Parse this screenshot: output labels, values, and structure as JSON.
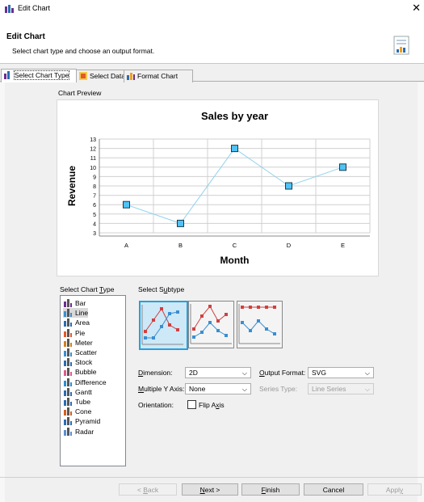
{
  "window": {
    "title": "Edit Chart"
  },
  "header": {
    "title": "Edit Chart",
    "subtitle": "Select chart type and choose an output format."
  },
  "tabs": [
    {
      "label": "Select Chart Type"
    },
    {
      "label": "Select Data"
    },
    {
      "label": "Format Chart"
    }
  ],
  "preview": {
    "label": "Chart Preview"
  },
  "chart_data": {
    "type": "line",
    "title": "Sales by year",
    "xlabel": "Month",
    "ylabel": "Revenue",
    "categories": [
      "A",
      "B",
      "C",
      "D",
      "E"
    ],
    "values": [
      6,
      4,
      12,
      8,
      10
    ],
    "ylim": [
      3,
      13
    ],
    "yticks": [
      3,
      4,
      5,
      6,
      7,
      8,
      9,
      10,
      11,
      12,
      13
    ],
    "grid": true,
    "line_color": "#8fd3ef",
    "marker_color": "#4fc3f7"
  },
  "chart_type": {
    "label_pre": "Select Chart ",
    "label_u": "T",
    "label_post": "ype",
    "items": [
      "Bar",
      "Line",
      "Area",
      "Pie",
      "Meter",
      "Scatter",
      "Stock",
      "Bubble",
      "Difference",
      "Gantt",
      "Tube",
      "Cone",
      "Pyramid",
      "Radar"
    ],
    "selected": "Line"
  },
  "subtype": {
    "label_pre": "Select S",
    "label_u": "u",
    "label_post": "btype"
  },
  "form": {
    "dimension_label": "Dimension:",
    "dimension_value": "2D",
    "multiple_y_label": "Multiple Y Axis:",
    "multiple_y_value": "None",
    "orientation_label": "Orientation:",
    "flip_axis_label": "Flip Axis",
    "output_format_label": "Output Format:",
    "output_format_value": "SVG",
    "series_type_label": "Series Type:",
    "series_type_value": "Line Series"
  },
  "buttons": {
    "back": "< Back",
    "next": "Next >",
    "finish": "Finish",
    "cancel": "Cancel",
    "apply": "Apply"
  }
}
